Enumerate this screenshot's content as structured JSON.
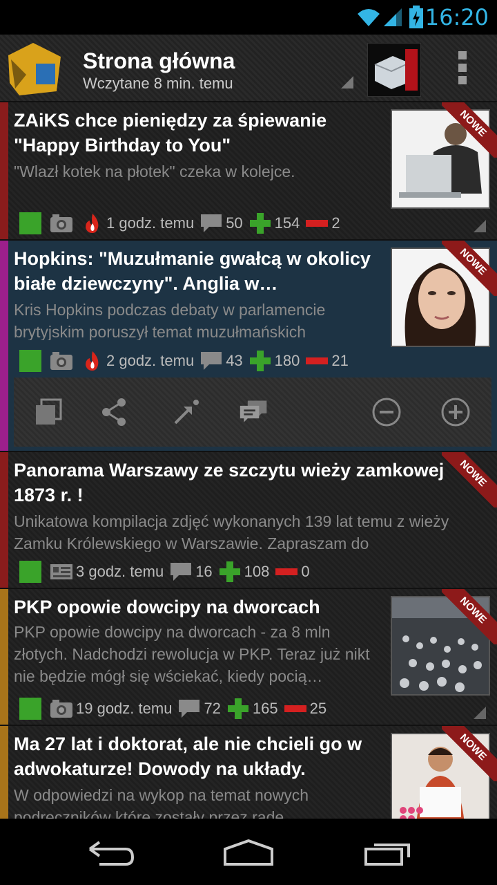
{
  "status": {
    "time": "16:20"
  },
  "header": {
    "title": "Strona główna",
    "subtitle": "Wczytane 8 min. temu"
  },
  "colors": {
    "accent": "#33b5e5",
    "ribbon": "#8d1a1a",
    "upvote": "#3aa32a",
    "downvote": "#d42020"
  },
  "ribbon_label": "NOWE",
  "items": [
    {
      "title": "ZAiKS chce pieniędzy za śpiewanie \"Happy Birthday to You\"",
      "desc": "\"Wlazł kotek na płotek\" czeka w kolejce.",
      "time": "1 godz. temu",
      "comments": "50",
      "up": "154",
      "down": "2",
      "bar_color": "#8a1c1c",
      "type_icon": "camera-icon",
      "hot": true
    },
    {
      "title": "Hopkins: \"Muzułmanie gwałcą w okolicy białe dziewczyny\". Anglia w…",
      "desc": "Kris Hopkins podczas debaty w parlamencie brytyjskim poruszył temat muzułmańskich",
      "time": "2 godz. temu",
      "comments": "43",
      "up": "180",
      "down": "21",
      "bar_color": "#9c1f8c",
      "type_icon": "camera-icon",
      "hot": true
    },
    {
      "title": "Panorama Warszawy ze szczytu wieży zamkowej 1873 r. !",
      "desc": "Unikatowa kompilacja zdjęć wykonanych 139 lat temu z wieży Zamku Królewskiego w Warszawie. Zapraszam do",
      "time": "3 godz. temu",
      "comments": "16",
      "up": "108",
      "down": "0",
      "bar_color": "#8a1c1c",
      "type_icon": "article-icon",
      "hot": false
    },
    {
      "title": "PKP opowie dowcipy na dworcach",
      "desc": "PKP opowie dowcipy na dworcach - za 8 mln złotych. Nadchodzi rewolucja w PKP. Teraz już nikt nie będzie mógł się wściekać, kiedy pocią…",
      "time": "19 godz. temu",
      "comments": "72",
      "up": "165",
      "down": "25",
      "bar_color": "#a8741a",
      "type_icon": "camera-icon",
      "hot": false
    },
    {
      "title": "Ma 27 lat i doktorat, ale nie chcieli go w adwokaturze! Dowody na układy.",
      "desc": "W odpowiedzi na wykop na temat nowych podręczników które zostały przez rade",
      "bar_color": "#a8741a"
    }
  ]
}
